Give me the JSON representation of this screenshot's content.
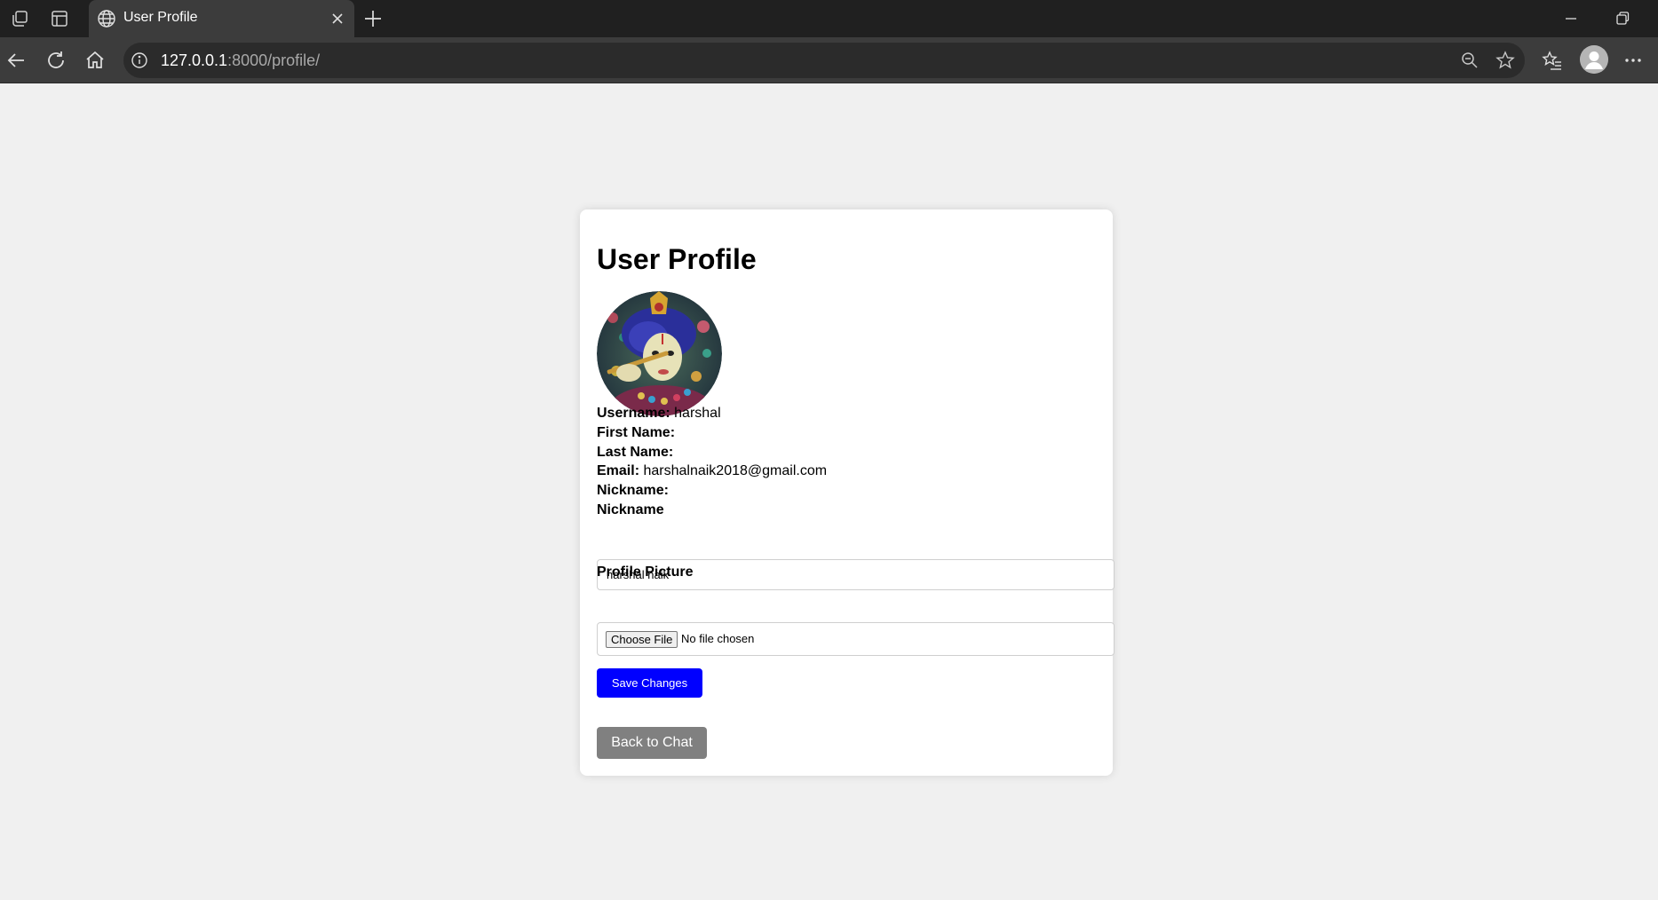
{
  "browser": {
    "tab": {
      "title": "User Profile",
      "icon": "globe-icon"
    },
    "address": {
      "host": "127.0.0.1",
      "rest": ":8000/profile/"
    }
  },
  "profile": {
    "title": "User Profile",
    "picture_alt": "Profile picture",
    "fields": [
      {
        "label": "Username:",
        "value": "harshal"
      },
      {
        "label": "First Name:",
        "value": ""
      },
      {
        "label": "Last Name:",
        "value": ""
      },
      {
        "label": "Email:",
        "value": "harshalnaik2018@gmail.com"
      },
      {
        "label": "Nickname:",
        "value": ""
      }
    ],
    "form": {
      "nickname_label": "Nickname",
      "nickname_value": "harshal naik",
      "picture_label": "Profile Picture",
      "choose_file": "Choose File",
      "file_status": "No file chosen",
      "save_label": "Save Changes"
    },
    "back_label": "Back to Chat"
  },
  "colors": {
    "save_button": "#0000ff",
    "back_button": "#808080",
    "page_background": "#f0f0f0",
    "tab_strip": "#202020",
    "toolbar": "#3c3c3c"
  }
}
